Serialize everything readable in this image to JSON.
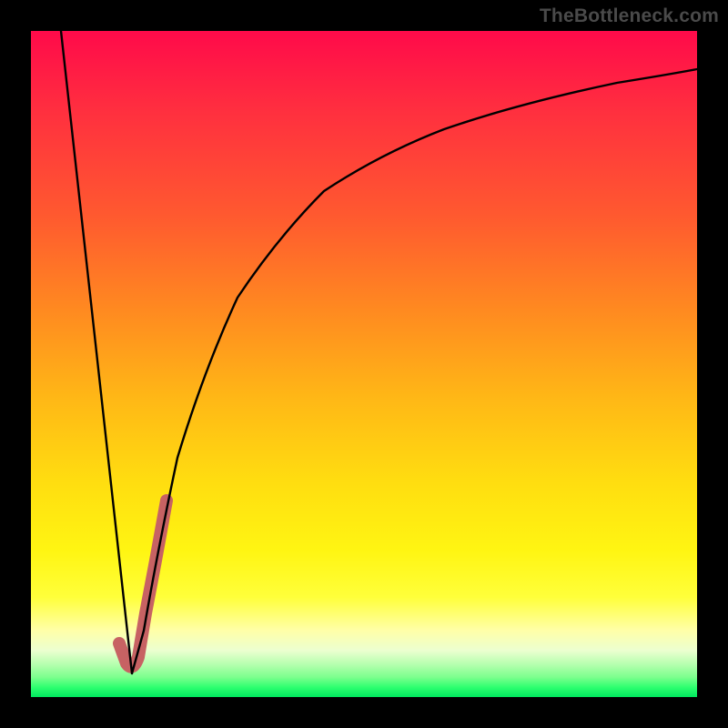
{
  "watermark": "TheBottleneck.com",
  "colors": {
    "background_frame": "#000000",
    "gradient_top": "#ff0a4a",
    "gradient_mid": "#ffde10",
    "gradient_bottom": "#00e85e",
    "curve": "#000000",
    "highlight_segment": "#c76263"
  },
  "chart_data": {
    "type": "line",
    "title": "",
    "xlabel": "",
    "ylabel": "",
    "xlim": [
      0,
      100
    ],
    "ylim": [
      0,
      100
    ],
    "grid": false,
    "series": [
      {
        "name": "left-steep-line",
        "x": [
          4.5,
          15.2
        ],
        "values": [
          100,
          3.5
        ]
      },
      {
        "name": "right-log-curve",
        "x": [
          15.2,
          17,
          19,
          22,
          26,
          31,
          37,
          44,
          52,
          62,
          74,
          88,
          100
        ],
        "values": [
          3.5,
          10,
          22,
          36,
          49,
          60,
          69,
          76,
          81.5,
          86,
          89.5,
          92.4,
          94.3
        ]
      },
      {
        "name": "highlight-valley-segment",
        "stroke": "#c76263",
        "stroke_width_px": 14,
        "x": [
          13.3,
          14.4,
          15.2,
          16.0,
          17.2,
          18.7,
          20.4
        ],
        "values": [
          8.0,
          5.0,
          3.7,
          6.0,
          12.5,
          20.5,
          29.5
        ]
      }
    ],
    "annotations": [
      {
        "text": "TheBottleneck.com",
        "position": "top-right"
      }
    ]
  }
}
